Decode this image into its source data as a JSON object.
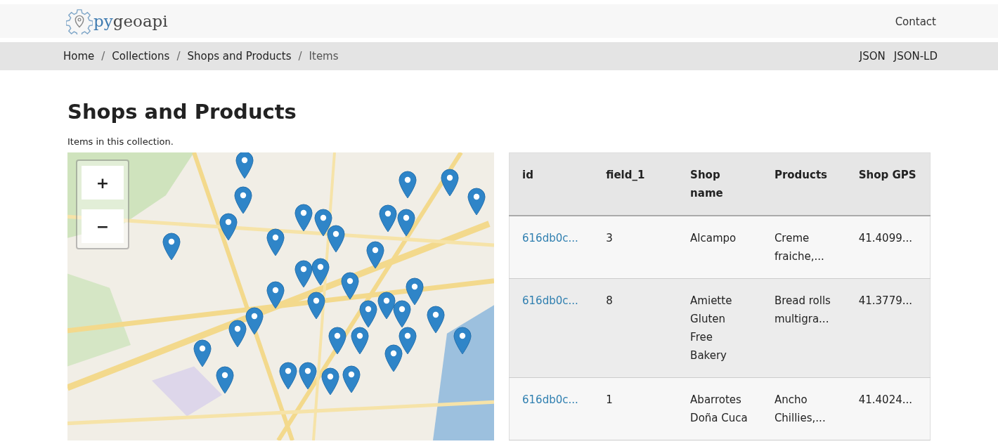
{
  "header": {
    "logo": {
      "part_1": "py",
      "part_2": "geoapi"
    },
    "links": [
      "Contact"
    ]
  },
  "breadcrumb": [
    {
      "kind": "link",
      "label": "Home"
    },
    {
      "kind": "separator",
      "label": "/"
    },
    {
      "kind": "link",
      "label": "Collections"
    },
    {
      "kind": "separator",
      "label": "/"
    },
    {
      "kind": "link",
      "label": "Shops and Products"
    },
    {
      "kind": "separator",
      "label": "/"
    },
    {
      "kind": "current",
      "label": "Items"
    }
  ],
  "formats": [
    "JSON",
    "JSON-LD"
  ],
  "title": "Shops and Products",
  "description": "Items in this collection.",
  "map": {
    "kind": "picture",
    "zoom_in": "+",
    "zoom_out": "−"
  },
  "table": {
    "columns": [
      "id",
      "field_1",
      "Shop name",
      "Products",
      "Shop GPS"
    ],
    "rows": [
      {
        "cells": [
          "616db0c...",
          "3",
          "Alcampo",
          "Creme fraiche,...",
          "41.4099..."
        ]
      },
      {
        "cells": [
          "616db0c...",
          "8",
          "Amiette Gluten Free Bakery",
          "Bread rolls multigra...",
          "41.3779..."
        ]
      },
      {
        "cells": [
          "616db0c...",
          "1",
          "Abarrotes Doña Cuca",
          "Ancho Chillies,...",
          "41.4024..."
        ]
      }
    ]
  }
}
